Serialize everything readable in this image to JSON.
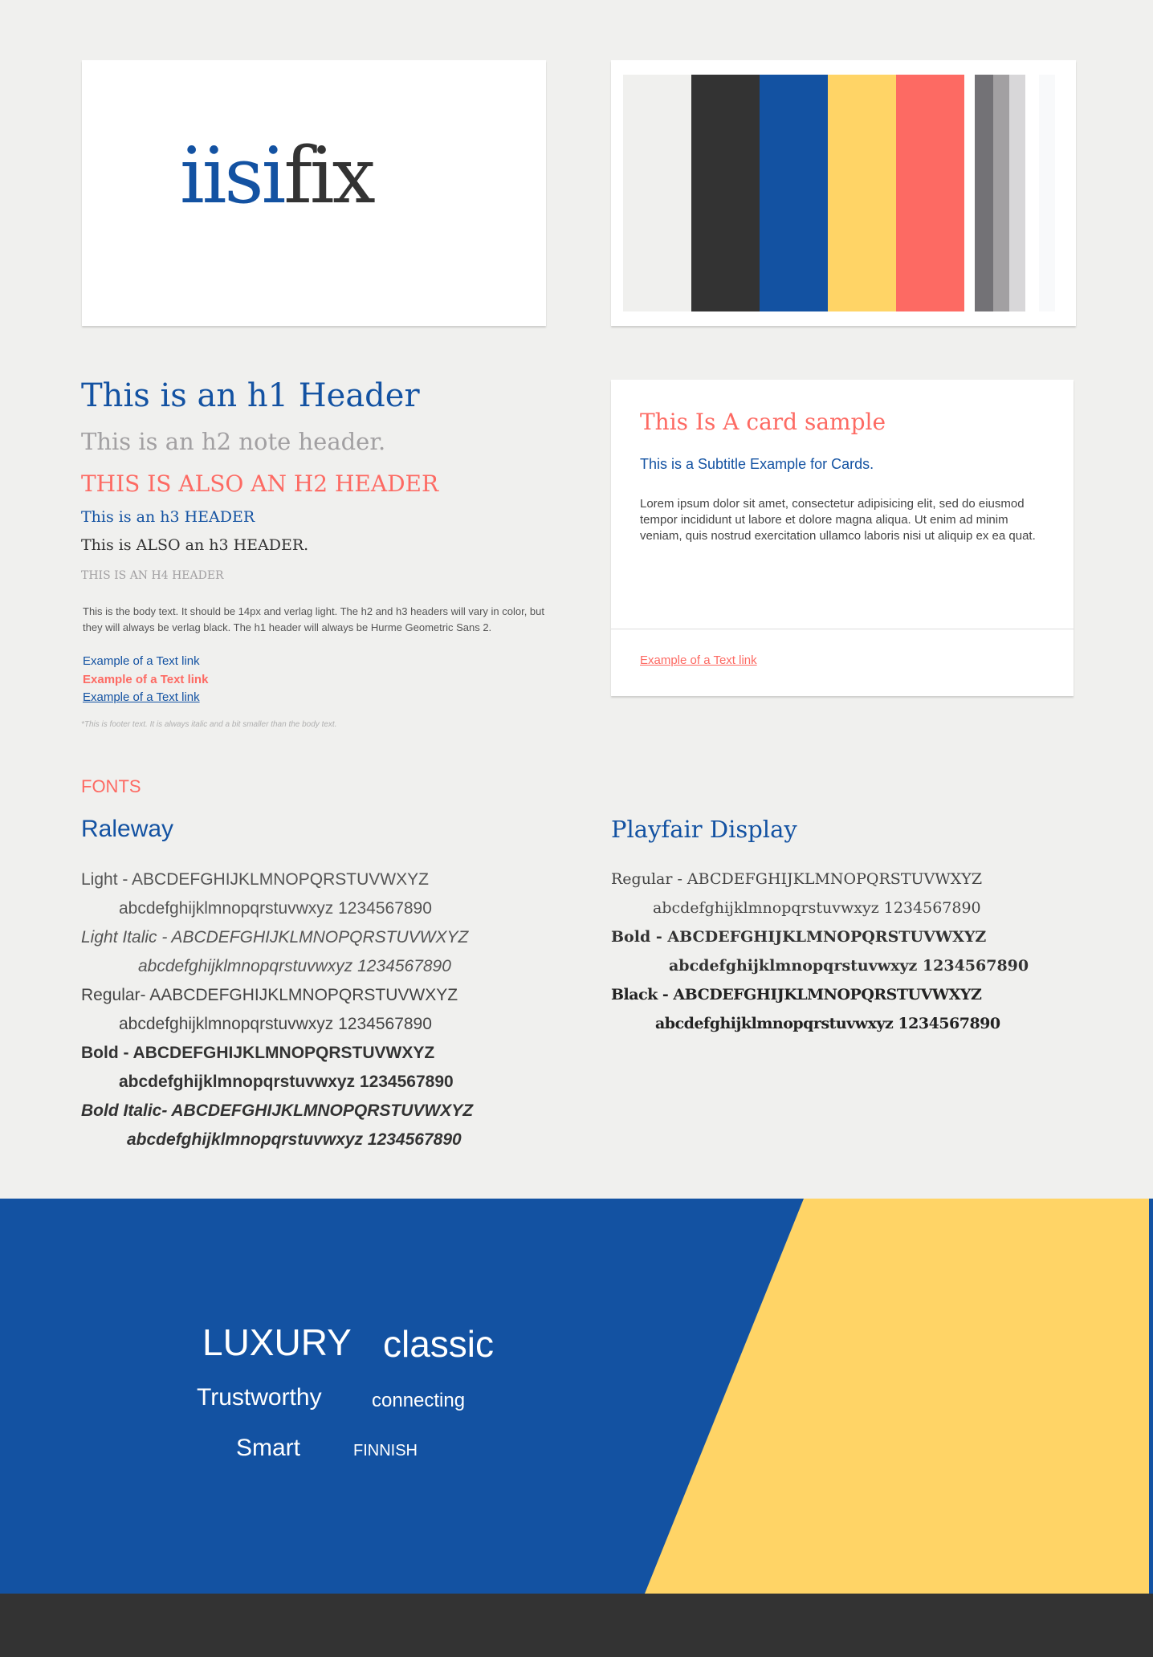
{
  "logo": {
    "part1": "iisi",
    "part2": "fix"
  },
  "palette": {
    "primary": [
      "#f0f0ee",
      "#333333",
      "#1352a2",
      "#ffd466",
      "#fd6a63"
    ],
    "greys": [
      "#737276",
      "#a2a0a2",
      "#d8d7d9"
    ],
    "extra": [
      "#f8f9fa"
    ]
  },
  "typography": {
    "h1": "This is an h1 Header",
    "h2_note": "This is an h2 note header.",
    "h2_alt": "THIS IS ALSO AN H2 HEADER",
    "h3": "This is an h3 HEADER",
    "h3_alt": "This is ALSO an h3 HEADER.",
    "h4": "THIS IS AN H4 HEADER",
    "body": "This is the body text. It should be 14px and verlag light. The h2 and h3 headers will vary in color, but they will always be verlag black. The h1 header will always be Hurme Geometric Sans 2.",
    "links": [
      "Example of a Text link",
      "Example of a Text link",
      "Example of a Text link"
    ],
    "footer": "*This is footer text. It is always italic and a bit smaller than the body text."
  },
  "card": {
    "title": "This Is A card sample",
    "subtitle": "This is a Subtitle Example for Cards.",
    "body": "Lorem ipsum dolor sit amet, consectetur adipisicing elit, sed do eiusmod tempor incididunt ut labore et dolore magna aliqua. Ut enim ad minim veniam, quis nostrud exercitation ullamco laboris nisi ut aliquip ex ea quat.",
    "link": "Example of a Text link"
  },
  "fonts": {
    "label": "FONTS",
    "raleway": {
      "name": "Raleway",
      "rows": [
        [
          "Light - ABCDEFGHIJKLMNOPQRSTUVWXYZ",
          "abcdefghijklmnopqrstuvwxyz 1234567890"
        ],
        [
          "Light Italic - ABCDEFGHIJKLMNOPQRSTUVWXYZ",
          "abcdefghijklmnopqrstuvwxyz 1234567890"
        ],
        [
          "Regular- AABCDEFGHIJKLMNOPQRSTUVWXYZ",
          "abcdefghijklmnopqrstuvwxyz 1234567890"
        ],
        [
          "Bold - ABCDEFGHIJKLMNOPQRSTUVWXYZ",
          "abcdefghijklmnopqrstuvwxyz 1234567890"
        ],
        [
          "Bold Italic- ABCDEFGHIJKLMNOPQRSTUVWXYZ",
          "abcdefghijklmnopqrstuvwxyz 1234567890"
        ]
      ]
    },
    "playfair": {
      "name": "Playfair Display",
      "rows": [
        [
          "Regular - ABCDEFGHIJKLMNOPQRSTUVWXYZ",
          "abcdefghijklmnopqrstuvwxyz 1234567890"
        ],
        [
          "Bold - ABCDEFGHIJKLMNOPQRSTUVWXYZ",
          "abcdefghijklmnopqrstuvwxyz 1234567890"
        ],
        [
          "Black - ABCDEFGHIJKLMNOPQRSTUVWXYZ",
          "abcdefghijklmnopqrstuvwxyz 1234567890"
        ]
      ]
    }
  },
  "keywords": [
    "LUXURY",
    "classic",
    "Trustworthy",
    "connecting",
    "Smart",
    "FINNISH"
  ],
  "colors": {
    "blue": "#1352a2",
    "coral": "#fd6a63",
    "yellow": "#ffd466",
    "dark": "#333333",
    "grey": "#a2a0a2"
  }
}
